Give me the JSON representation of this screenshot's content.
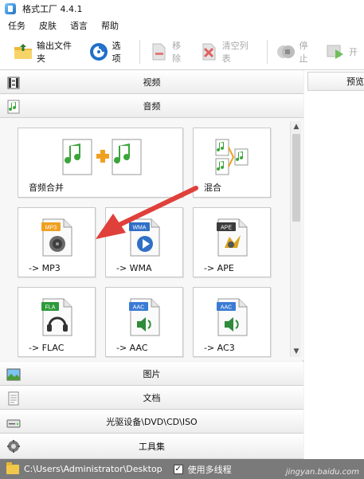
{
  "window": {
    "title": "格式工厂 4.4.1"
  },
  "menu": [
    "任务",
    "皮肤",
    "语言",
    "帮助"
  ],
  "toolbar": {
    "output_folder": "输出文件夹",
    "options": "选项",
    "remove": "移除",
    "clear_list": "清空列表",
    "stop": "停止",
    "start": "开"
  },
  "categories": {
    "video": "视频",
    "audio": "音频",
    "picture": "图片",
    "document": "文档",
    "optical": "光驱设备\\DVD\\CD\\ISO",
    "tools": "工具集"
  },
  "audio_tiles": {
    "merge": "音频合并",
    "mix": "混合",
    "mp3": "-> MP3",
    "wma": "-> WMA",
    "ape": "-> APE",
    "flac": "-> FLAC",
    "aac": "-> AAC",
    "ac3": "-> AC3"
  },
  "file_badges": {
    "mp3": "MP3",
    "wma": "WMA",
    "ape": "APE",
    "fla": "FLA",
    "aac": "AAC",
    "aac2": "AAC"
  },
  "preview": {
    "header": "预览"
  },
  "status": {
    "path": "C:\\Users\\Administrator\\Desktop",
    "multithread_label": "使用多线程",
    "multithread_checked": "✓",
    "watermark": "jingyan.baidu.com"
  },
  "colors": {
    "accent_red": "#e0403a",
    "statusbar": "#7a7a7a",
    "mp3_badge": "#f0a020",
    "wma_badge": "#2f6fc6",
    "ape_badge": "#3b3b3b",
    "fla_badge": "#2c9a3a",
    "aac_badge": "#3a7bd5"
  }
}
